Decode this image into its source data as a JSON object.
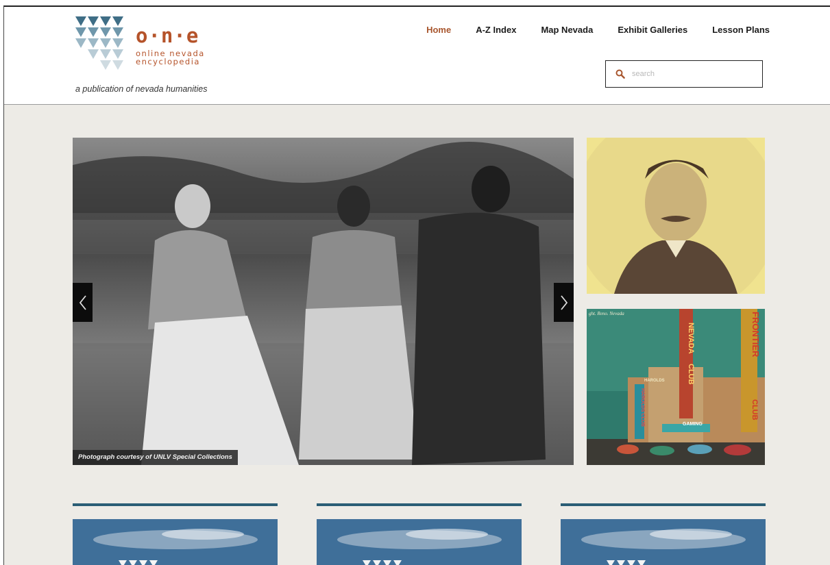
{
  "header": {
    "logo_title": "o·n·e",
    "logo_subtitle_line1": "online nevada",
    "logo_subtitle_line2": "encyclopedia",
    "tagline": "a publication of nevada humanities"
  },
  "nav": {
    "items": [
      {
        "label": "Home",
        "active": true
      },
      {
        "label": "A-Z Index",
        "active": false
      },
      {
        "label": "Map Nevada",
        "active": false
      },
      {
        "label": "Exhibit Galleries",
        "active": false
      },
      {
        "label": "Lesson Plans",
        "active": false
      }
    ]
  },
  "search": {
    "placeholder": "search",
    "value": "",
    "icon": "search-icon"
  },
  "hero": {
    "caption": "Photograph courtesy of UNLV Special Collections",
    "prev_icon": "chevron-left-icon",
    "next_icon": "chevron-right-icon"
  },
  "side_thumbs": {
    "postcard_caption": "ght. Reno. Nevada",
    "neon_nevada": "NEVADA",
    "neon_club": "CLUB",
    "neon_frontier": "FRONTIER",
    "neon_club2": "CLUB",
    "neon_harolds": "HAROLDS",
    "neon_harolds_club": "HAROLDS CLUB",
    "neon_gaming": "GAMING"
  },
  "colors": {
    "accent": "#a8562e",
    "logo_blue": "#3f6e86",
    "card_rule": "#2a5d75",
    "page_bg": "#edebe6"
  }
}
